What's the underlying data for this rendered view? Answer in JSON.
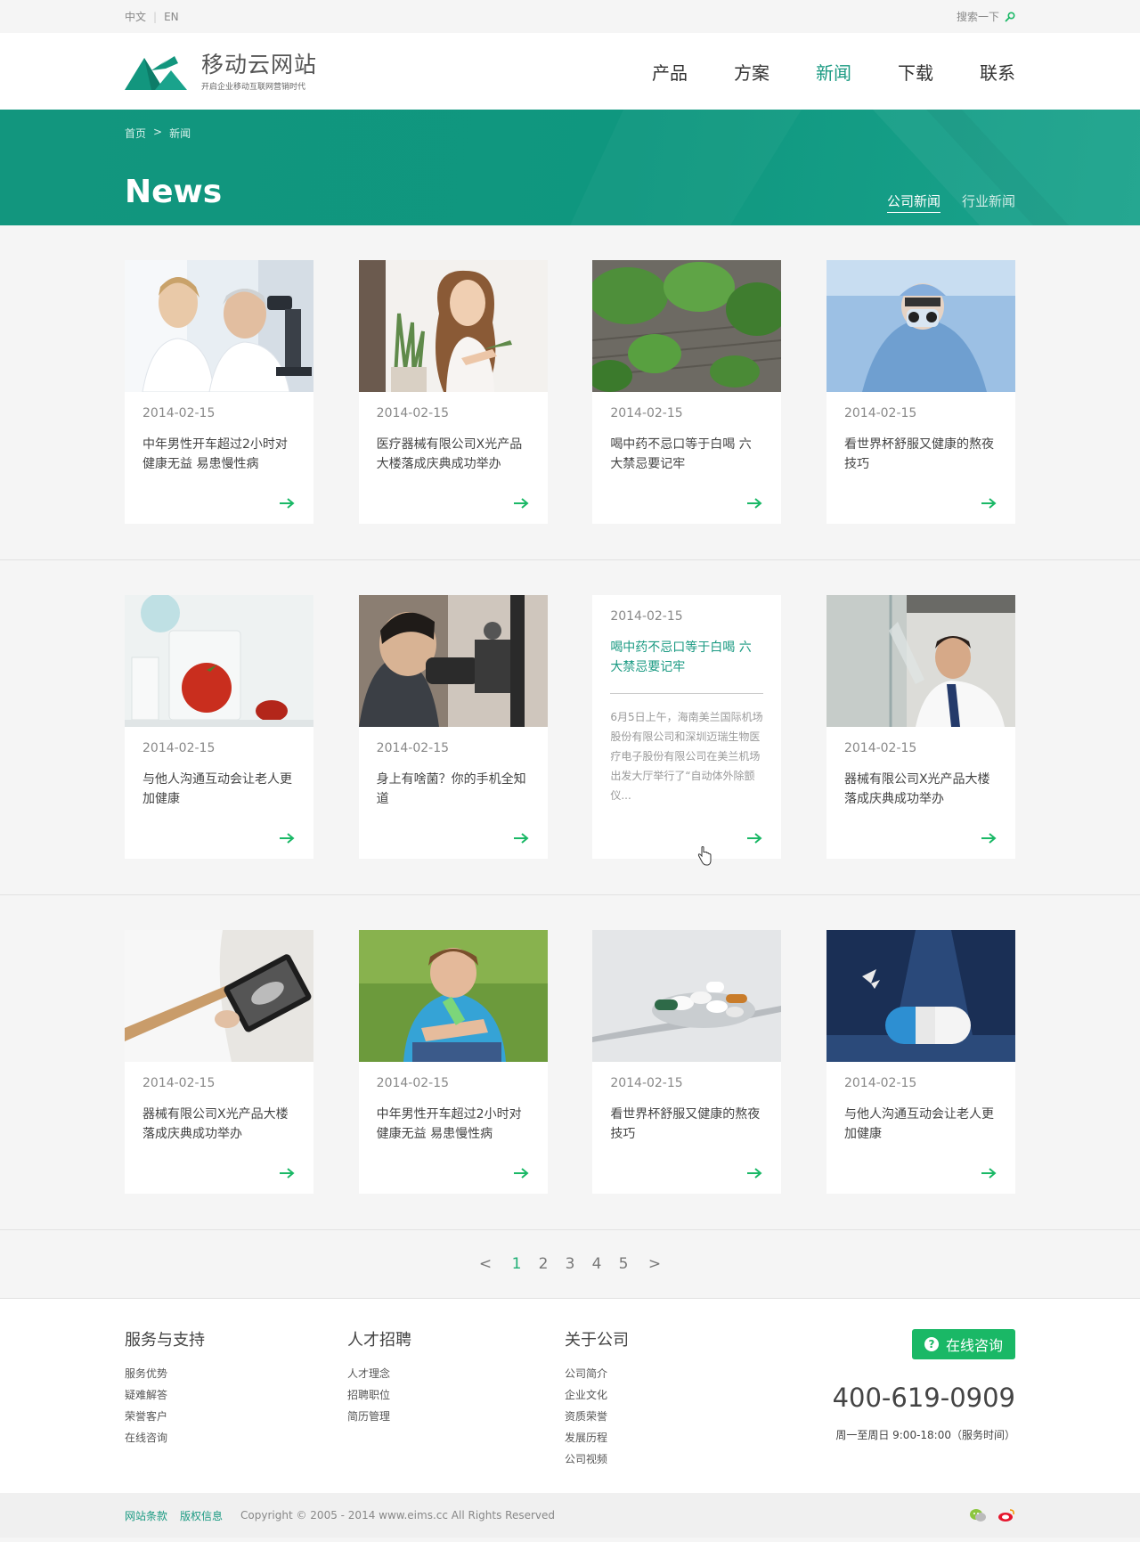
{
  "topbar": {
    "lang_cn": "中文",
    "lang_en": "EN",
    "search_label": "搜索一下"
  },
  "brand": {
    "title": "移动云网站",
    "subtitle": "开启企业移动互联网营销时代"
  },
  "nav": {
    "items": [
      "产品",
      "方案",
      "新闻",
      "下载",
      "联系"
    ],
    "active": "新闻"
  },
  "banner": {
    "breadcrumb_home": "首页",
    "breadcrumb_sep": ">",
    "breadcrumb_current": "新闻",
    "title": "News",
    "tab_company": "公司新闻",
    "tab_industry": "行业新闻"
  },
  "cards": [
    {
      "date": "2014-02-15",
      "title": "中年男性开车超过2小时对健康无益 易患慢性病",
      "image": "scientists-microscope"
    },
    {
      "date": "2014-02-15",
      "title": "医疗器械有限公司X光产品大楼落成庆典成功举办",
      "image": "woman-aloe"
    },
    {
      "date": "2014-02-15",
      "title": "喝中药不忌口等于白喝 六大禁忌要记牢",
      "image": "lotus-leaves"
    },
    {
      "date": "2014-02-15",
      "title": "看世界杯舒服又健康的熬夜技巧",
      "image": "surgeon"
    },
    {
      "date": "2014-02-15",
      "title": "与他人沟通互动会让老人更加健康",
      "image": "tomato-beaker"
    },
    {
      "date": "2014-02-15",
      "title": "身上有啥菌？你的手机全知道",
      "image": "eye-exam"
    },
    {
      "date": "2014-02-15",
      "title": "喝中药不忌口等于白喝 六大禁忌要记牢",
      "desc": "6月5日上午，海南美兰国际机场股份有限公司和深圳迈瑞生物医疗电子股份有限公司在美兰机场出发大厅举行了“自动体外除颤仪...",
      "hover": true
    },
    {
      "date": "2014-02-15",
      "title": "器械有限公司X光产品大楼落成庆典成功举办",
      "image": "doctor-glass"
    },
    {
      "date": "2014-02-15",
      "title": "器械有限公司X光产品大楼落成庆典成功举办",
      "image": "doctor-tablet"
    },
    {
      "date": "2014-02-15",
      "title": "中年男性开车超过2小时对健康无益 易患慢性病",
      "image": "boy-bandage"
    },
    {
      "date": "2014-02-15",
      "title": "看世界杯舒服又健康的熬夜技巧",
      "image": "pills-spoon"
    },
    {
      "date": "2014-02-15",
      "title": "与他人沟通互动会让老人更加健康",
      "image": "capsule-blue"
    }
  ],
  "pagination": {
    "prev": "<",
    "pages": [
      "1",
      "2",
      "3",
      "4",
      "5"
    ],
    "current": "1",
    "next": ">"
  },
  "footer": {
    "col1": {
      "title": "服务与支持",
      "links": [
        "服务优势",
        "疑难解答",
        "荣誉客户",
        "在线咨询"
      ]
    },
    "col2": {
      "title": "人才招聘",
      "links": [
        "人才理念",
        "招聘职位",
        "简历管理"
      ]
    },
    "col3": {
      "title": "关于公司",
      "links": [
        "公司简介",
        "企业文化",
        "资质荣誉",
        "发展历程",
        "公司视频"
      ]
    },
    "consult_label": "在线咨询",
    "phone": "400-619-0909",
    "hours": "周一至周日 9:00-18:00（服务时间）"
  },
  "bottom": {
    "terms": "网站条款",
    "copyright_info": "版权信息",
    "copyright": "Copyright © 2005 - 2014 www.eims.cc All Rights Reserved"
  },
  "colors": {
    "brand": "#12967e",
    "accent_green": "#1ab866",
    "active_text": "#1a9a82"
  }
}
